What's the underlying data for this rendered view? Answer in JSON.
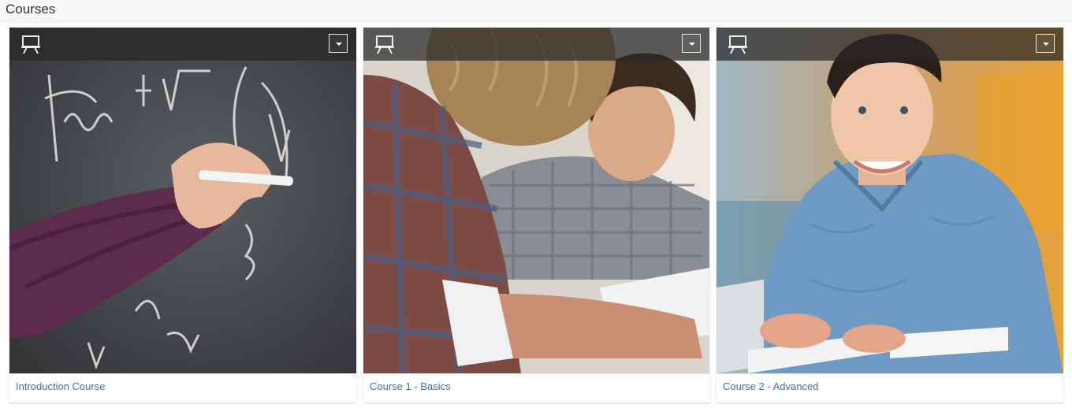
{
  "page": {
    "title": "Courses"
  },
  "courses": [
    {
      "name": "Introduction Course",
      "icon": "presentation-board-icon",
      "menu_icon": "caret-down-icon"
    },
    {
      "name": "Course 1 - Basics",
      "icon": "presentation-board-icon",
      "menu_icon": "caret-down-icon"
    },
    {
      "name": "Course 2 - Advanced",
      "icon": "presentation-board-icon",
      "menu_icon": "caret-down-icon"
    }
  ]
}
